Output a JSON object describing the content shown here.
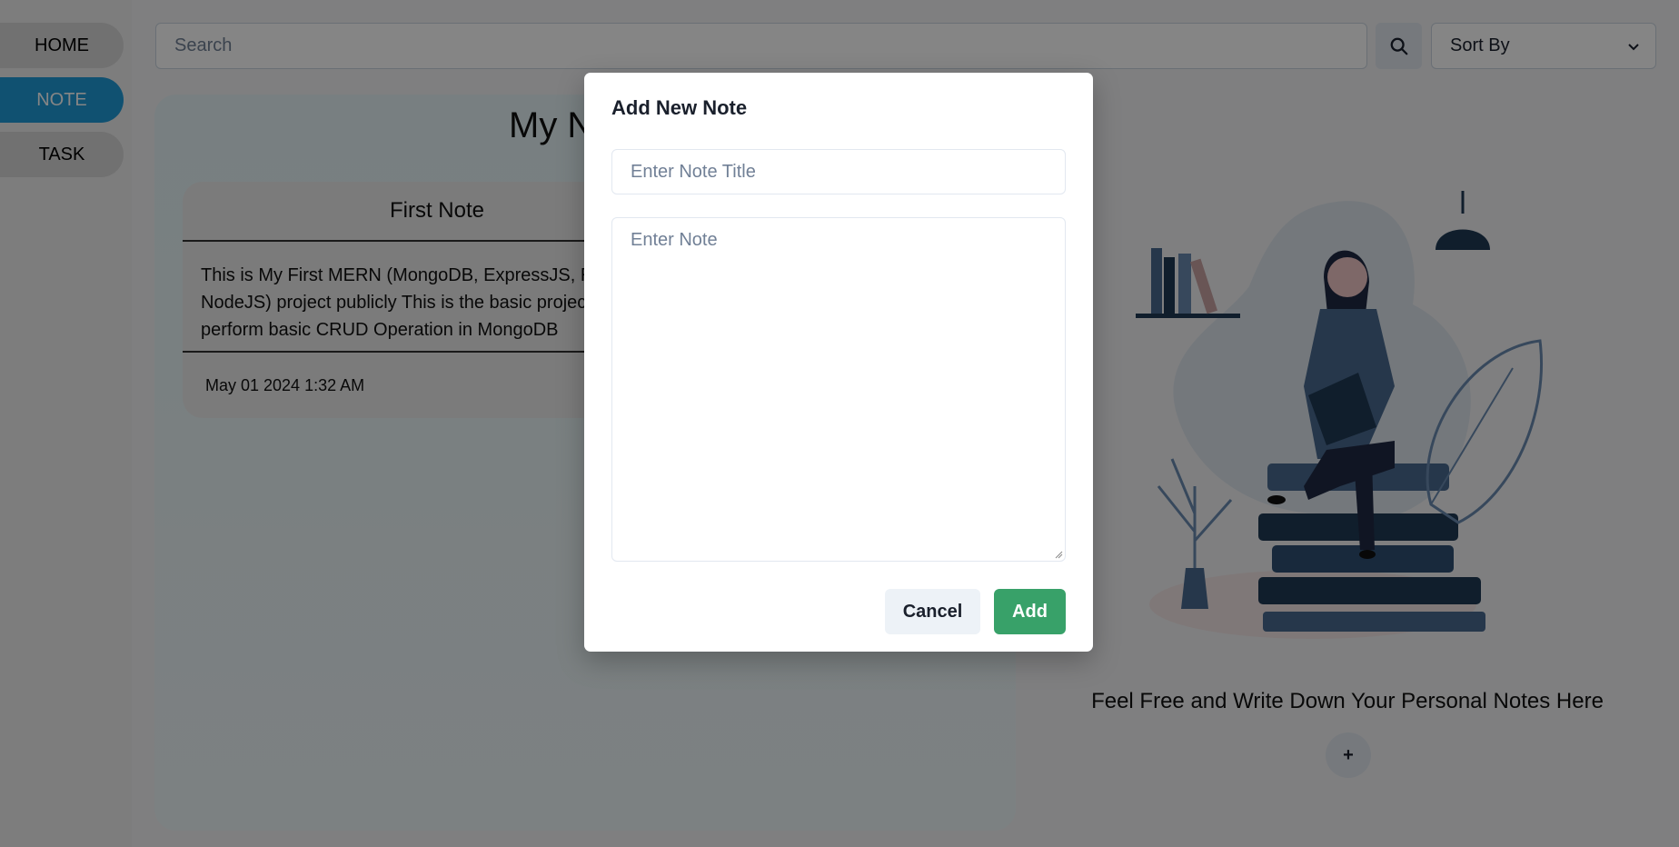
{
  "sidebar": {
    "items": [
      {
        "label": "HOME",
        "active": false
      },
      {
        "label": "NOTE",
        "active": true
      },
      {
        "label": "TASK",
        "active": false
      }
    ]
  },
  "topbar": {
    "search_placeholder": "Search",
    "search_icon": "search-icon",
    "sort_label": "Sort By",
    "sort_icon": "chevron-down-icon"
  },
  "notes": {
    "title": "My Notes",
    "cards": [
      {
        "title": "First Note",
        "body": "This is My First MERN (MongoDB, ExpressJS, ReactJS, NodeJS) project publicly This is the basic project which perform basic CRUD Operation in MongoDB",
        "date": "May 01 2024 1:32 AM"
      }
    ]
  },
  "aside": {
    "tagline": "Feel Free and Write Down Your Personal Notes Here",
    "add_label": "+"
  },
  "modal": {
    "title": "Add New Note",
    "title_placeholder": "Enter Note Title",
    "note_placeholder": "Enter Note",
    "cancel_label": "Cancel",
    "add_label": "Add"
  },
  "colors": {
    "accent_blue": "#1f9bd9",
    "add_green": "#38a169",
    "overlay": "rgba(0,0,0,0.48)"
  }
}
